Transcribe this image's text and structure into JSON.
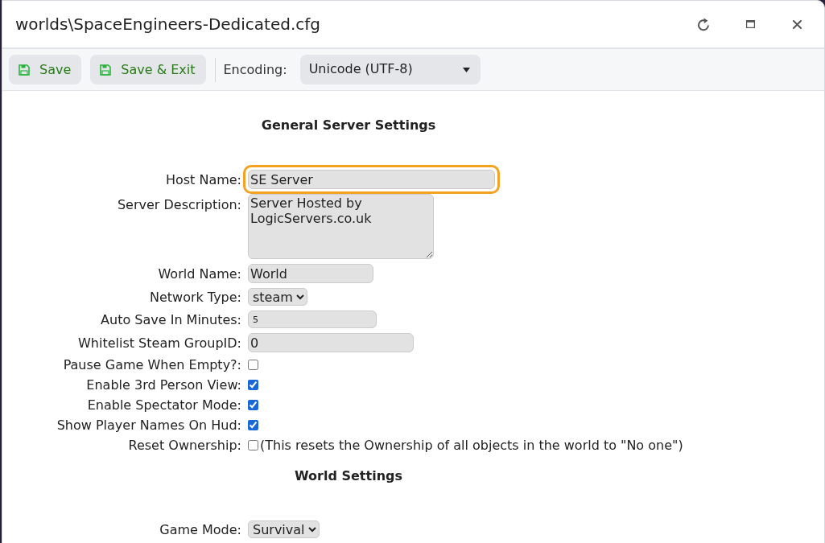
{
  "window": {
    "title": "worlds\\SpaceEngineers-Dedicated.cfg"
  },
  "toolbar": {
    "buttons": [
      {
        "label": "Save"
      },
      {
        "label": "Save & Exit"
      }
    ],
    "encoding": {
      "label": "Encoding:",
      "value": "Unicode (UTF-8)"
    }
  },
  "sections": [
    {
      "heading": "General Server Settings",
      "fields": [
        {
          "kind": "text",
          "label": "Host Name:",
          "value": "SE Server",
          "focused": true
        },
        {
          "kind": "textarea",
          "label": "Server Description:",
          "value": "Server Hosted by LogicServers.co.uk",
          "focused": false
        },
        {
          "kind": "text",
          "label": "World Name:",
          "value": "World",
          "focused": false
        },
        {
          "kind": "select",
          "label": "Network Type:",
          "value": "steam",
          "focused": false
        },
        {
          "kind": "number",
          "label": "Auto Save In Minutes:",
          "value": "5",
          "focused": false
        },
        {
          "kind": "text",
          "label": "Whitelist Steam GroupID:",
          "value": "0",
          "focused": false
        },
        {
          "kind": "checkbox",
          "label": "Pause Game When Empty?:",
          "checked": false,
          "focused": false
        },
        {
          "kind": "checkbox",
          "label": "Enable 3rd Person View:",
          "checked": true,
          "focused": false
        },
        {
          "kind": "checkbox",
          "label": "Enable Spectator Mode:",
          "checked": true,
          "focused": false
        },
        {
          "kind": "checkbox",
          "label": "Show Player Names On Hud:",
          "checked": true,
          "focused": false
        },
        {
          "kind": "checkbox",
          "label": "Reset Ownership:",
          "checked": false,
          "focused": false,
          "note": "(This resets the Ownership of all objects in the world to \"No one\")"
        }
      ]
    },
    {
      "heading": "World Settings",
      "fields": [
        {
          "kind": "select",
          "label": "Game Mode:",
          "value": "Survival",
          "focused": false
        }
      ]
    }
  ]
}
